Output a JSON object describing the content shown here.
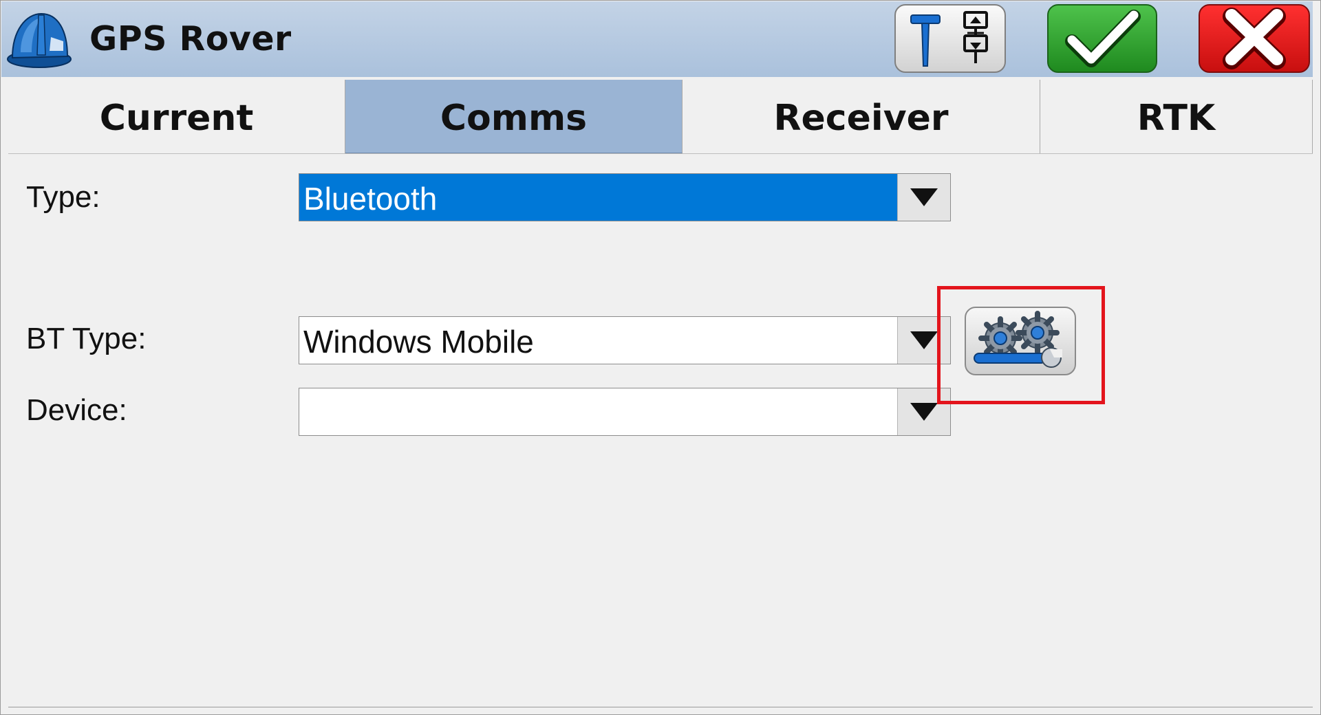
{
  "window": {
    "title": "GPS Rover",
    "icons": {
      "app": "hard-hat-icon",
      "rover": "gps-rover-pole-icon",
      "ok": "checkmark-icon",
      "close": "close-x-icon"
    }
  },
  "tabs": [
    {
      "label": "Current",
      "active": false
    },
    {
      "label": "Comms",
      "active": true
    },
    {
      "label": "Receiver",
      "active": false
    },
    {
      "label": "RTK",
      "active": false
    }
  ],
  "form": {
    "type": {
      "label": "Type:",
      "value": "Bluetooth"
    },
    "bt_type": {
      "label": "BT Type:",
      "value": "Windows Mobile"
    },
    "device": {
      "label": "Device:",
      "value": ""
    },
    "settings_button_icon": "gears-wrench-icon"
  },
  "colors": {
    "titlebar": "#aec4de",
    "active_tab": "#9ab4d4",
    "selection": "#0078d7",
    "ok_button": "#2fa02c",
    "close_button": "#e01818",
    "highlight": "#e3141c"
  }
}
